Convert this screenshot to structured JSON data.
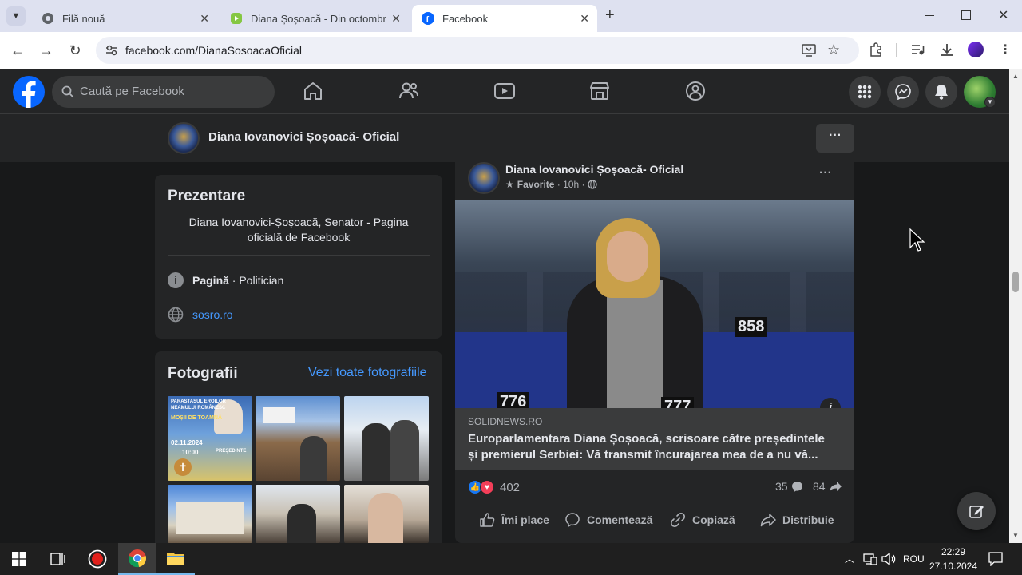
{
  "browser": {
    "tabs": [
      {
        "title": "Filă nouă",
        "active": false
      },
      {
        "title": "Diana Șoșoacă - Din octombrie",
        "active": false
      },
      {
        "title": "Facebook",
        "active": true
      }
    ],
    "url": "facebook.com/DianaSosoacaOficial"
  },
  "facebook": {
    "search_placeholder": "Caută pe Facebook",
    "page_name": "Diana Iovanovici Șoșoacă- Oficial",
    "intro": {
      "title": "Prezentare",
      "bio": "Diana Iovanovici-Șoșoacă, Senator - Pagina oficială de Facebook",
      "category_bold": "Pagină",
      "category_rest": " · Politician",
      "website": "sosro.ro"
    },
    "photos": {
      "title": "Fotografii",
      "see_all": "Vezi toate fotografiile",
      "poster_lines": [
        "PARASTASUL EROILOR",
        "NEAMULUI ROMÂNESC",
        "MOȘII DE TOAMNĂ",
        "02.11.2024",
        "10:00",
        "PREȘEDINTE"
      ]
    },
    "post": {
      "author": "Diana Iovanovici Șoșoacă- Oficial",
      "meta_label": "Favorite",
      "meta_time": " · 10h · ",
      "seat_numbers": [
        "858",
        "776",
        "777"
      ],
      "link_source": "SOLIDNEWS.RO",
      "link_title": "Europarlamentara Diana Șoșoacă, scrisoare către președintele și premierul Serbiei: Vă transmit încurajarea mea de a nu vă...",
      "reactions_count": "402",
      "comments_count": "35",
      "shares_count": "84",
      "actions": {
        "like": "Îmi place",
        "comment": "Comentează",
        "copy": "Copiază",
        "share": "Distribuie"
      }
    }
  },
  "taskbar": {
    "language": "ROU",
    "time": "22:29",
    "date": "27.10.2024"
  },
  "colors": {
    "fb_blue": "#0866ff",
    "link_blue": "#4599ff",
    "dark_bg": "#18191a",
    "card_bg": "#242526"
  }
}
